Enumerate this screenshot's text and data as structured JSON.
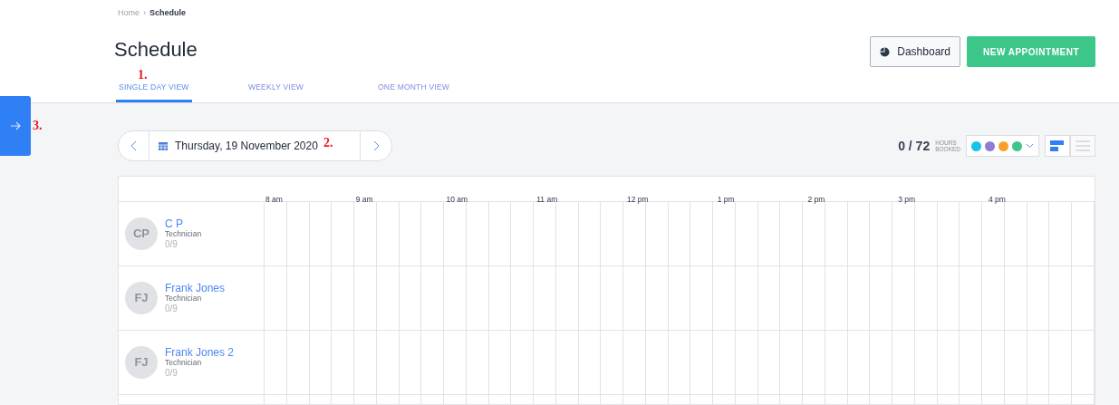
{
  "breadcrumb": [
    {
      "label": "Home"
    },
    {
      "label": "Schedule"
    }
  ],
  "breadcrumb_separator": "›",
  "title": "Schedule",
  "header_buttons": [
    {
      "kind": "outline",
      "label": "Dashboard"
    },
    {
      "kind": "primary",
      "label": "NEW APPOINTMENT"
    }
  ],
  "tabs": [
    {
      "label": "SINGLE DAY VIEW",
      "selected": true,
      "annotation": "1."
    },
    {
      "label": "WEEKLY VIEW",
      "selected": false
    },
    {
      "label": "ONE MONTH VIEW",
      "selected": false
    }
  ],
  "sidebar_toggle": {
    "annotation": "3."
  },
  "date_picker": {
    "date": "Thursday, 19 November 2020",
    "annotation": "2."
  },
  "hours_summary": {
    "value": "0 / 72",
    "label_line_1": "HOURS",
    "label_line_2": "BOOKED"
  },
  "color_filter": [
    {
      "color": "#17c1e8"
    },
    {
      "color": "#8e7cd6"
    },
    {
      "color": "#f7a12b"
    },
    {
      "color": "#3cc68a"
    }
  ],
  "view_toggle": [
    {
      "kind": "timeline",
      "selected": true
    },
    {
      "kind": "list",
      "selected": false
    }
  ],
  "schedule": {
    "hours": [
      "8 am",
      "9 am",
      "10 am",
      "11 am",
      "12 pm",
      "1 pm",
      "2 pm",
      "3 pm",
      "4 pm"
    ],
    "staff": [
      {
        "initials": "CP",
        "name": "C P",
        "role": "Technician",
        "booked": "0/9"
      },
      {
        "initials": "FJ",
        "name": "Frank Jones",
        "role": "Technician",
        "booked": "0/9"
      },
      {
        "initials": "FJ",
        "name": "Frank Jones 2",
        "role": "Technician",
        "booked": "0/9"
      }
    ]
  }
}
